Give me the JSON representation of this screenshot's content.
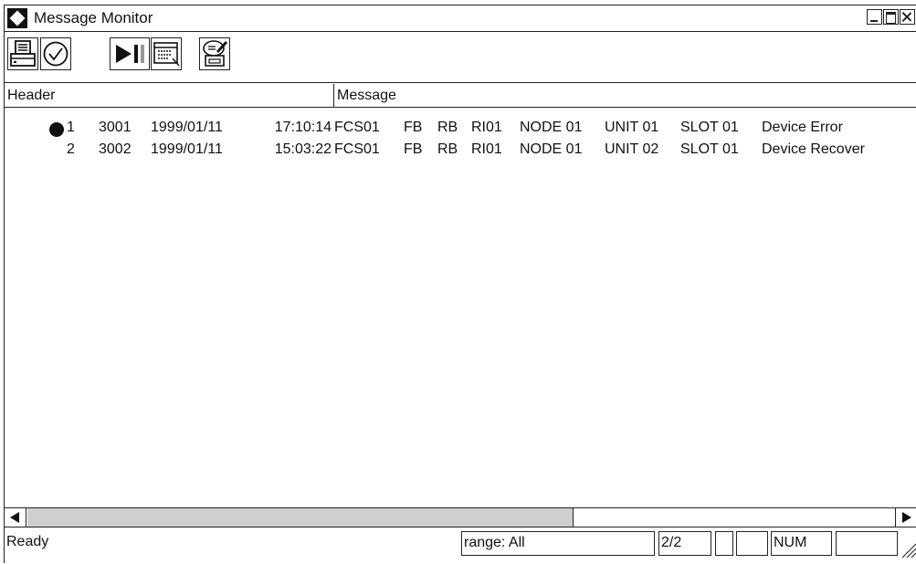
{
  "window": {
    "title": "Message Monitor",
    "icon": "diamond-app-icon",
    "controls": [
      "minimize-icon",
      "maximize-icon",
      "close-icon"
    ]
  },
  "toolbar": {
    "buttons": [
      {
        "name": "print",
        "icon": "printer-icon"
      },
      {
        "name": "acknowledge",
        "icon": "checkmark-icon"
      },
      {
        "name": "play-pause",
        "icon": "play-pause-icon"
      },
      {
        "name": "message-list",
        "icon": "list-window-icon"
      },
      {
        "name": "print-settings",
        "icon": "printer-edit-icon"
      }
    ]
  },
  "columns": {
    "header": "Header",
    "message": "Message"
  },
  "messages": [
    {
      "no": "1",
      "marked": true,
      "code": "3001",
      "date": "1999/01/11",
      "time": "17:10:14",
      "station": "FCS01",
      "f1": "FB",
      "f2": "RB",
      "card": "RI01",
      "node": "NODE 01",
      "unit": "UNIT 01",
      "slot": "SLOT 01",
      "text": "Device Error"
    },
    {
      "no": "2",
      "marked": false,
      "code": "3002",
      "date": "1999/01/11",
      "time": "15:03:22",
      "station": "FCS01",
      "f1": "FB",
      "f2": "RB",
      "card": "RI01",
      "node": "NODE 01",
      "unit": "UNIT 02",
      "slot": "SLOT 01",
      "text": "Device Recover"
    }
  ],
  "scrollbar": {
    "thumb_fraction": 0.63
  },
  "status": {
    "ready": "Ready",
    "range": "range: All",
    "page": "2/2",
    "blank1": "",
    "blank2": "",
    "num": "NUM",
    "blank3": ""
  },
  "colors": {
    "foreground": "#111111",
    "background": "#ffffff",
    "scroll_thumb": "#cfcfcf"
  }
}
